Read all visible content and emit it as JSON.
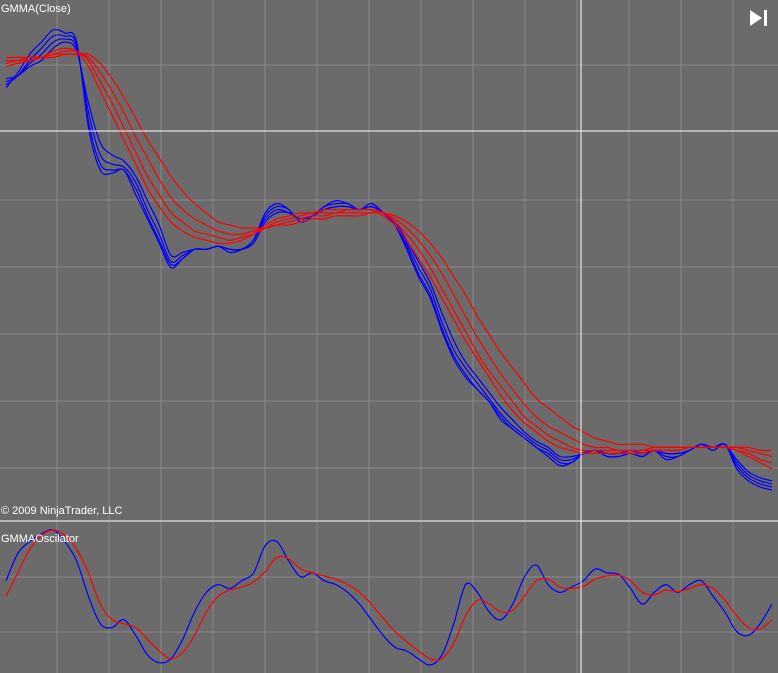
{
  "panels": {
    "main_label": "GMMA(Close)",
    "copyright": "© 2009 NinjaTrader, LLC",
    "osc_label": "GMMAOscilator"
  },
  "icons": {
    "goto_end": "skip-to-end-icon"
  },
  "colors": {
    "background": "#6b6b6b",
    "grid": "#8a8a8a",
    "short_ma": "#0000ff",
    "long_ma": "#ff0000",
    "crosshair": "#ffffff"
  },
  "chart_data": [
    {
      "type": "line",
      "title": "GMMA(Close)",
      "grid": true,
      "series": [
        {
          "group": "short",
          "values": [
            0.75,
            0.8,
            0.86,
            0.9,
            0.94,
            0.93,
            0.9,
            0.62,
            0.48,
            0.47,
            0.48,
            0.4,
            0.32,
            0.24,
            0.16,
            0.19,
            0.22,
            0.22,
            0.23,
            0.21,
            0.22,
            0.25,
            0.34,
            0.37,
            0.35,
            0.31,
            0.33,
            0.36,
            0.38,
            0.37,
            0.35,
            0.37,
            0.34,
            0.3,
            0.22,
            0.13,
            0.06,
            -0.05,
            -0.14,
            -0.2,
            -0.24,
            -0.28,
            -0.34,
            -0.37,
            -0.4,
            -0.43,
            -0.46,
            -0.49,
            -0.48,
            -0.45,
            -0.44,
            -0.46,
            -0.46,
            -0.45,
            -0.46,
            -0.44,
            -0.47,
            -0.46,
            -0.44,
            -0.42,
            -0.44,
            -0.42,
            -0.5,
            -0.54,
            -0.56,
            -0.57
          ]
        },
        {
          "group": "short",
          "values": [
            0.76,
            0.79,
            0.84,
            0.88,
            0.92,
            0.92,
            0.89,
            0.64,
            0.5,
            0.48,
            0.48,
            0.42,
            0.33,
            0.25,
            0.17,
            0.19,
            0.22,
            0.22,
            0.23,
            0.22,
            0.22,
            0.25,
            0.33,
            0.36,
            0.35,
            0.31,
            0.33,
            0.36,
            0.37,
            0.37,
            0.35,
            0.37,
            0.34,
            0.3,
            0.23,
            0.14,
            0.07,
            -0.04,
            -0.13,
            -0.19,
            -0.24,
            -0.28,
            -0.33,
            -0.37,
            -0.4,
            -0.43,
            -0.45,
            -0.48,
            -0.48,
            -0.45,
            -0.44,
            -0.46,
            -0.46,
            -0.45,
            -0.46,
            -0.44,
            -0.46,
            -0.46,
            -0.44,
            -0.42,
            -0.44,
            -0.42,
            -0.49,
            -0.53,
            -0.55,
            -0.56
          ]
        },
        {
          "group": "short",
          "values": [
            0.77,
            0.79,
            0.83,
            0.86,
            0.9,
            0.91,
            0.88,
            0.67,
            0.53,
            0.5,
            0.49,
            0.44,
            0.35,
            0.27,
            0.18,
            0.2,
            0.22,
            0.22,
            0.23,
            0.22,
            0.22,
            0.25,
            0.32,
            0.35,
            0.34,
            0.32,
            0.33,
            0.35,
            0.36,
            0.36,
            0.35,
            0.36,
            0.34,
            0.3,
            0.24,
            0.16,
            0.09,
            -0.02,
            -0.11,
            -0.17,
            -0.22,
            -0.27,
            -0.32,
            -0.36,
            -0.39,
            -0.42,
            -0.44,
            -0.47,
            -0.47,
            -0.45,
            -0.44,
            -0.45,
            -0.45,
            -0.45,
            -0.45,
            -0.44,
            -0.45,
            -0.45,
            -0.44,
            -0.42,
            -0.43,
            -0.42,
            -0.48,
            -0.52,
            -0.54,
            -0.55
          ]
        },
        {
          "group": "short",
          "values": [
            0.78,
            0.79,
            0.82,
            0.84,
            0.88,
            0.9,
            0.87,
            0.7,
            0.57,
            0.53,
            0.51,
            0.46,
            0.38,
            0.3,
            0.2,
            0.21,
            0.22,
            0.22,
            0.23,
            0.22,
            0.22,
            0.24,
            0.31,
            0.34,
            0.34,
            0.32,
            0.33,
            0.35,
            0.36,
            0.36,
            0.35,
            0.36,
            0.34,
            0.31,
            0.25,
            0.18,
            0.11,
            0.01,
            -0.08,
            -0.15,
            -0.2,
            -0.25,
            -0.3,
            -0.34,
            -0.38,
            -0.41,
            -0.43,
            -0.46,
            -0.46,
            -0.45,
            -0.44,
            -0.45,
            -0.45,
            -0.44,
            -0.45,
            -0.44,
            -0.45,
            -0.45,
            -0.44,
            -0.42,
            -0.43,
            -0.42,
            -0.47,
            -0.51,
            -0.53,
            -0.54
          ]
        },
        {
          "group": "long",
          "values": [
            0.82,
            0.83,
            0.84,
            0.85,
            0.87,
            0.88,
            0.87,
            0.82,
            0.74,
            0.66,
            0.58,
            0.5,
            0.42,
            0.36,
            0.31,
            0.28,
            0.26,
            0.25,
            0.24,
            0.24,
            0.25,
            0.27,
            0.3,
            0.32,
            0.33,
            0.34,
            0.34,
            0.35,
            0.35,
            0.35,
            0.35,
            0.35,
            0.33,
            0.3,
            0.25,
            0.19,
            0.13,
            0.06,
            -0.01,
            -0.08,
            -0.14,
            -0.2,
            -0.26,
            -0.31,
            -0.35,
            -0.38,
            -0.41,
            -0.43,
            -0.44,
            -0.45,
            -0.45,
            -0.45,
            -0.45,
            -0.45,
            -0.45,
            -0.44,
            -0.44,
            -0.44,
            -0.43,
            -0.43,
            -0.43,
            -0.43,
            -0.44,
            -0.46,
            -0.48,
            -0.5
          ]
        },
        {
          "group": "long",
          "values": [
            0.83,
            0.84,
            0.84,
            0.85,
            0.86,
            0.87,
            0.87,
            0.84,
            0.77,
            0.7,
            0.62,
            0.54,
            0.46,
            0.4,
            0.34,
            0.31,
            0.28,
            0.27,
            0.26,
            0.25,
            0.26,
            0.27,
            0.29,
            0.31,
            0.32,
            0.33,
            0.34,
            0.34,
            0.34,
            0.35,
            0.35,
            0.35,
            0.34,
            0.31,
            0.27,
            0.22,
            0.16,
            0.09,
            0.02,
            -0.05,
            -0.12,
            -0.18,
            -0.23,
            -0.28,
            -0.33,
            -0.36,
            -0.39,
            -0.41,
            -0.43,
            -0.44,
            -0.44,
            -0.44,
            -0.44,
            -0.44,
            -0.44,
            -0.44,
            -0.44,
            -0.44,
            -0.43,
            -0.43,
            -0.43,
            -0.43,
            -0.44,
            -0.45,
            -0.47,
            -0.48
          ]
        },
        {
          "group": "long",
          "values": [
            0.84,
            0.84,
            0.85,
            0.85,
            0.86,
            0.86,
            0.86,
            0.85,
            0.8,
            0.74,
            0.67,
            0.59,
            0.52,
            0.45,
            0.39,
            0.35,
            0.32,
            0.3,
            0.28,
            0.27,
            0.27,
            0.28,
            0.29,
            0.3,
            0.31,
            0.32,
            0.33,
            0.33,
            0.34,
            0.34,
            0.34,
            0.34,
            0.34,
            0.32,
            0.29,
            0.25,
            0.2,
            0.14,
            0.07,
            0.0,
            -0.07,
            -0.13,
            -0.19,
            -0.24,
            -0.29,
            -0.33,
            -0.36,
            -0.38,
            -0.4,
            -0.42,
            -0.43,
            -0.43,
            -0.44,
            -0.44,
            -0.44,
            -0.43,
            -0.43,
            -0.43,
            -0.43,
            -0.43,
            -0.43,
            -0.43,
            -0.43,
            -0.44,
            -0.45,
            -0.46
          ]
        },
        {
          "group": "long",
          "values": [
            0.85,
            0.85,
            0.85,
            0.85,
            0.85,
            0.86,
            0.86,
            0.86,
            0.83,
            0.78,
            0.72,
            0.65,
            0.58,
            0.52,
            0.46,
            0.41,
            0.37,
            0.34,
            0.31,
            0.3,
            0.29,
            0.29,
            0.29,
            0.3,
            0.3,
            0.31,
            0.32,
            0.32,
            0.33,
            0.33,
            0.33,
            0.34,
            0.34,
            0.33,
            0.31,
            0.28,
            0.24,
            0.19,
            0.13,
            0.07,
            0.0,
            -0.06,
            -0.12,
            -0.17,
            -0.22,
            -0.27,
            -0.3,
            -0.33,
            -0.36,
            -0.38,
            -0.4,
            -0.41,
            -0.42,
            -0.42,
            -0.42,
            -0.43,
            -0.43,
            -0.43,
            -0.43,
            -0.43,
            -0.43,
            -0.43,
            -0.43,
            -0.43,
            -0.44,
            -0.44
          ]
        }
      ]
    },
    {
      "type": "line",
      "title": "GMMAOscilator",
      "grid": true,
      "series": [
        {
          "group": "oscillator",
          "values": [
            0.2,
            0.55,
            0.7,
            0.8,
            0.85,
            0.7,
            0.45,
            0.0,
            -0.35,
            -0.4,
            -0.3,
            -0.5,
            -0.75,
            -0.85,
            -0.8,
            -0.55,
            -0.2,
            0.05,
            0.15,
            0.1,
            0.2,
            0.3,
            0.65,
            0.7,
            0.45,
            0.25,
            0.3,
            0.2,
            0.15,
            0.05,
            -0.1,
            -0.3,
            -0.5,
            -0.65,
            -0.7,
            -0.8,
            -0.88,
            -0.75,
            -0.35,
            0.15,
            0.05,
            -0.2,
            -0.3,
            -0.1,
            0.25,
            0.4,
            0.15,
            0.05,
            0.12,
            0.2,
            0.35,
            0.3,
            0.28,
            0.1,
            -0.1,
            0.05,
            0.15,
            0.05,
            0.15,
            0.2,
            0.0,
            -0.2,
            -0.45,
            -0.5,
            -0.35,
            -0.1
          ]
        },
        {
          "group": "signal",
          "values": [
            0.0,
            0.3,
            0.6,
            0.78,
            0.85,
            0.78,
            0.6,
            0.3,
            -0.1,
            -0.3,
            -0.35,
            -0.4,
            -0.55,
            -0.7,
            -0.8,
            -0.72,
            -0.5,
            -0.2,
            0.0,
            0.08,
            0.12,
            0.18,
            0.32,
            0.5,
            0.48,
            0.35,
            0.3,
            0.26,
            0.22,
            0.15,
            0.05,
            -0.1,
            -0.28,
            -0.45,
            -0.58,
            -0.7,
            -0.8,
            -0.8,
            -0.6,
            -0.25,
            -0.05,
            -0.1,
            -0.2,
            -0.18,
            0.0,
            0.2,
            0.22,
            0.12,
            0.1,
            0.13,
            0.22,
            0.26,
            0.27,
            0.2,
            0.05,
            0.02,
            0.08,
            0.06,
            0.1,
            0.15,
            0.1,
            -0.05,
            -0.25,
            -0.4,
            -0.42,
            -0.3
          ]
        }
      ]
    }
  ]
}
